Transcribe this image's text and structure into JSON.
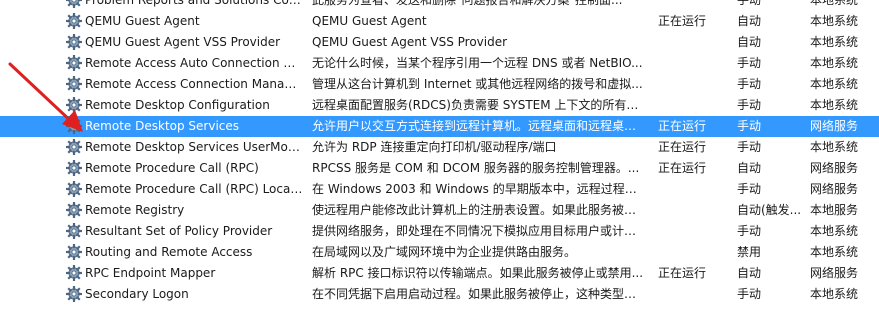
{
  "services": [
    {
      "name": "Problem Reports and Solutions Con...",
      "description": "此服务为查看、发送和删除\"问题报告和解决方案\"控制面...",
      "status": "",
      "startup": "手动",
      "logon": "本地系统"
    },
    {
      "name": "QEMU Guest Agent",
      "description": "QEMU Guest Agent",
      "status": "正在运行",
      "startup": "自动",
      "logon": "本地系统"
    },
    {
      "name": "QEMU Guest Agent VSS Provider",
      "description": "QEMU Guest Agent VSS Provider",
      "status": "",
      "startup": "自动",
      "logon": "本地系统"
    },
    {
      "name": "Remote Access Auto Connection M...",
      "description": "无论什么时候，当某个程序引用一个远程 DNS 或者 NetBIO...",
      "status": "",
      "startup": "手动",
      "logon": "本地系统"
    },
    {
      "name": "Remote Access Connection Manager",
      "description": "管理从这台计算机到 Internet 或其他远程网络的拨号和虚拟...",
      "status": "",
      "startup": "手动",
      "logon": "本地系统"
    },
    {
      "name": "Remote Desktop Configuration",
      "description": "远程桌面配置服务(RDCS)负责需要 SYSTEM 上下文的所有远...",
      "status": "",
      "startup": "手动",
      "logon": "本地系统"
    },
    {
      "name": "Remote Desktop Services",
      "description": "允许用户以交互方式连接到远程计算机。远程桌面和远程桌面...",
      "status": "正在运行",
      "startup": "手动",
      "logon": "网络服务",
      "selected": true
    },
    {
      "name": "Remote Desktop Services UserMod...",
      "description": "允许为 RDP 连接重定向打印机/驱动程序/端口",
      "status": "正在运行",
      "startup": "手动",
      "logon": "本地系统"
    },
    {
      "name": "Remote Procedure Call (RPC)",
      "description": "RPCSS 服务是 COM 和 DCOM 服务器的服务控制管理器。...",
      "status": "正在运行",
      "startup": "自动",
      "logon": "网络服务"
    },
    {
      "name": "Remote Procedure Call (RPC) Locator",
      "description": "在 Windows 2003 和 Windows 的早期版本中，远程过程调...",
      "status": "",
      "startup": "手动",
      "logon": "网络服务"
    },
    {
      "name": "Remote Registry",
      "description": "使远程用户能修改此计算机上的注册表设置。如果此服务被终...",
      "status": "",
      "startup": "自动(触发...",
      "logon": "本地服务"
    },
    {
      "name": "Resultant Set of Policy Provider",
      "description": "提供网络服务，即处理在不同情况下模拟应用目标用户或计算...",
      "status": "",
      "startup": "手动",
      "logon": "本地系统"
    },
    {
      "name": "Routing and Remote Access",
      "description": "在局域网以及广域网环境中为企业提供路由服务。",
      "status": "",
      "startup": "禁用",
      "logon": "本地系统"
    },
    {
      "name": "RPC Endpoint Mapper",
      "description": "解析 RPC 接口标识符以传输端点。如果此服务被停止或禁用...",
      "status": "正在运行",
      "startup": "自动",
      "logon": "网络服务"
    },
    {
      "name": "Secondary Logon",
      "description": "在不同凭据下启用启动过程。如果此服务被停止，这种类型的...",
      "status": "",
      "startup": "手动",
      "logon": "本地系统"
    }
  ],
  "colors": {
    "selection": "#3399ff",
    "annotation_arrow": "#e02020"
  },
  "icons": {
    "service": "gear-icon",
    "annotation": "red-arrow-annotation"
  }
}
